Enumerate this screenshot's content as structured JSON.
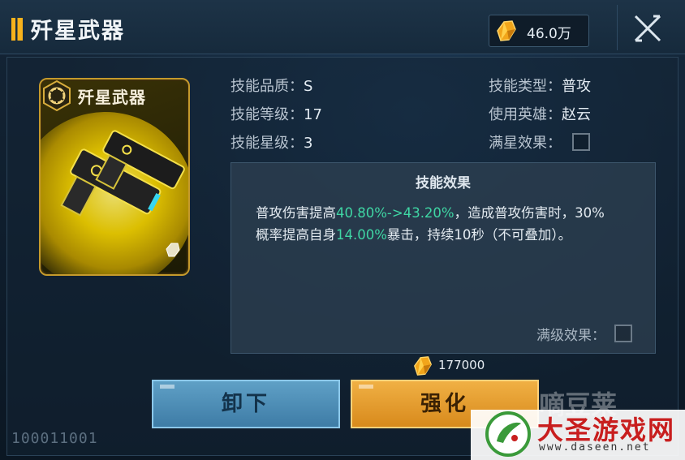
{
  "header": {
    "title": "歼星武器",
    "currency_amount": "46.0万",
    "currency_icon": "gold-crystal-icon",
    "close_icon": "close-x-icon"
  },
  "card": {
    "title": "歼星武器",
    "emblem_icon": "hexagon-emblem-icon",
    "corner_icon": "crystal-icon"
  },
  "info": {
    "quality_label": "技能品质：",
    "quality_value": "S",
    "level_label": "技能等级：",
    "level_value": "17",
    "star_label": "技能星级：",
    "star_value": "3",
    "type_label": "技能类型：",
    "type_value": "普攻",
    "hero_label": "使用英雄：",
    "hero_value": "赵云",
    "maxstar_label": "满星效果："
  },
  "effect": {
    "title": "技能效果",
    "line1_a": "普攻伤害提高",
    "line1_hl": "40.80%->43.20%",
    "line1_b": "，造成普攻伤害时，30%",
    "line2_a": "概率提高自身",
    "line2_hl": "14.00%",
    "line2_b": "暴击，持续10秒（不可叠加）。",
    "maxlevel_label": "满级效果："
  },
  "cost": {
    "amount": "177000",
    "icon": "gold-crystal-icon"
  },
  "buttons": {
    "unequip": "卸下",
    "upgrade": "强化"
  },
  "id_code": "100011001",
  "watermark": {
    "cn": "大圣游戏网",
    "url": "www.daseen.net",
    "faint": "嘀豆莱"
  },
  "colors": {
    "accent_gold": "#f7b21c",
    "highlight_green": "#3fd6a4",
    "unequip_blue": "#4c8db8",
    "upgrade_orange": "#e49a2c"
  }
}
